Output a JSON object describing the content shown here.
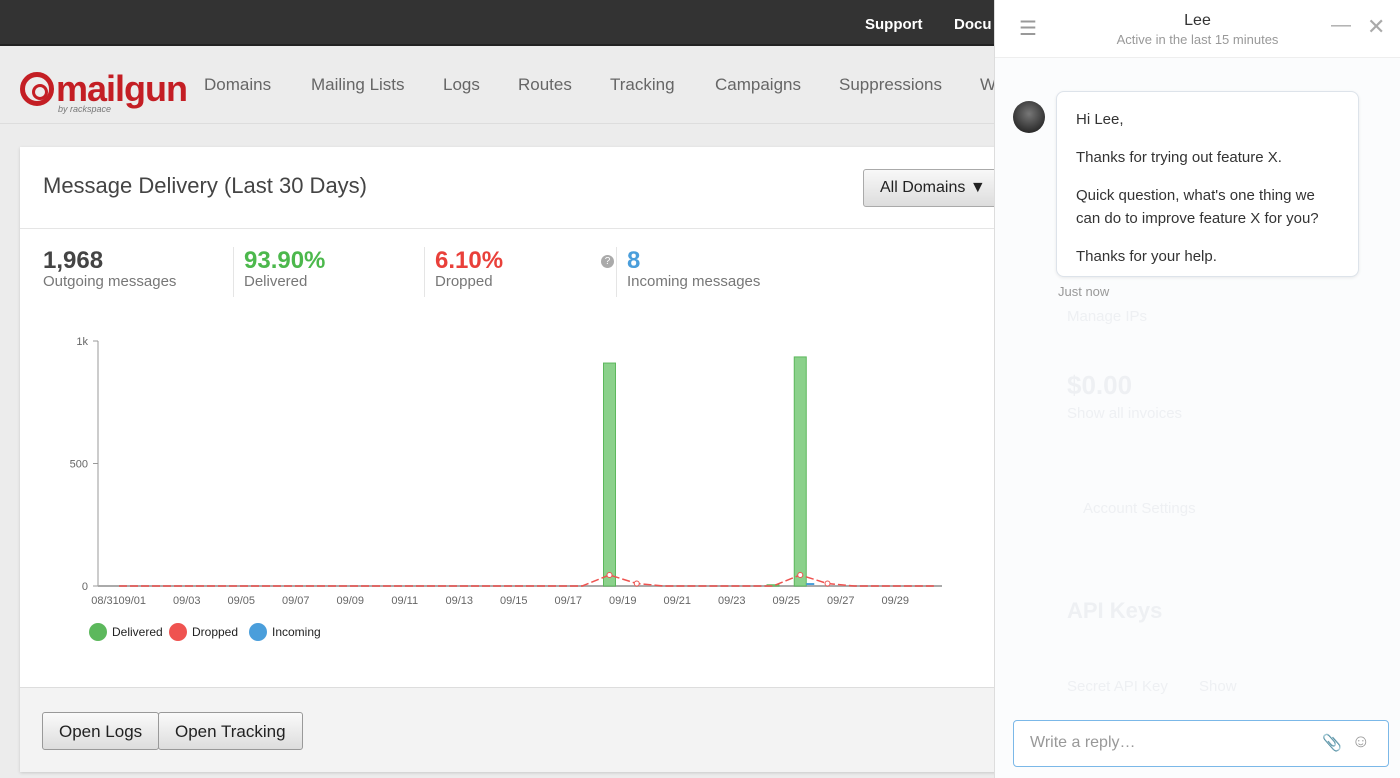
{
  "topbar": {
    "links": [
      "Support",
      "Docu"
    ]
  },
  "logo": {
    "text": "mailgun",
    "sub": "by rackspace"
  },
  "nav": {
    "items": [
      "Domains",
      "Mailing Lists",
      "Logs",
      "Routes",
      "Tracking",
      "Campaigns",
      "Suppressions",
      "W"
    ]
  },
  "card": {
    "title": "Message Delivery (Last 30 Days)",
    "domain_select": "All Domains",
    "stats": [
      {
        "value": "1,968",
        "label": "Outgoing messages",
        "color": "#444444"
      },
      {
        "value": "93.90%",
        "label": "Delivered",
        "color": "#4cb84c"
      },
      {
        "value": "6.10%",
        "label": "Dropped",
        "color": "#e9403a"
      },
      {
        "value": "8",
        "label": "Incoming messages",
        "color": "#4a9edb"
      }
    ],
    "buttons": {
      "open_logs": "Open Logs",
      "open_tracking": "Open Tracking"
    }
  },
  "chart_data": {
    "type": "bar",
    "ylim": [
      0,
      1000
    ],
    "yticks": [
      "0",
      "500",
      "1k"
    ],
    "xticks": [
      "08/31",
      "09/01",
      "09/03",
      "09/05",
      "09/07",
      "09/09",
      "09/11",
      "09/13",
      "09/15",
      "09/17",
      "09/19",
      "09/21",
      "09/23",
      "09/25",
      "09/27",
      "09/29"
    ],
    "x": [
      "08/31",
      "09/01",
      "09/02",
      "09/03",
      "09/04",
      "09/05",
      "09/06",
      "09/07",
      "09/08",
      "09/09",
      "09/10",
      "09/11",
      "09/12",
      "09/13",
      "09/14",
      "09/15",
      "09/16",
      "09/17",
      "09/18",
      "09/19",
      "09/20",
      "09/21",
      "09/22",
      "09/23",
      "09/24",
      "09/25",
      "09/26",
      "09/27",
      "09/28",
      "09/29",
      "09/30"
    ],
    "series": [
      {
        "name": "Delivered",
        "color": "#5cb85c",
        "type": "bar",
        "values": [
          0,
          0,
          0,
          0,
          0,
          0,
          0,
          0,
          0,
          0,
          0,
          0,
          0,
          0,
          0,
          0,
          0,
          0,
          910,
          0,
          0,
          0,
          0,
          0,
          5,
          935,
          0,
          0,
          0,
          0,
          0
        ]
      },
      {
        "name": "Dropped",
        "color": "#ef5350",
        "type": "line",
        "values": [
          0,
          0,
          0,
          0,
          0,
          0,
          0,
          0,
          0,
          0,
          0,
          0,
          0,
          0,
          0,
          0,
          0,
          0,
          45,
          10,
          0,
          0,
          0,
          0,
          0,
          45,
          10,
          0,
          0,
          0,
          0
        ]
      },
      {
        "name": "Incoming",
        "color": "#4a9edb",
        "type": "bar",
        "values": [
          0,
          0,
          0,
          0,
          0,
          0,
          0,
          0,
          0,
          0,
          0,
          0,
          0,
          0,
          0,
          0,
          0,
          0,
          0,
          0,
          0,
          0,
          0,
          0,
          0,
          8,
          0,
          0,
          0,
          0,
          0
        ]
      }
    ],
    "legend": "bottom-left"
  },
  "chat": {
    "name": "Lee",
    "status": "Active in the last 15 minutes",
    "messages": [
      "Hi Lee,",
      "Thanks for trying out feature X.",
      "Quick question, what's one thing we can do to improve feature X for you?",
      "Thanks for your help."
    ],
    "timestamp": "Just now",
    "reply_placeholder": "Write a reply…",
    "background": [
      "Manage IPs",
      "$0.00",
      "Show all invoices",
      "Account Settings",
      "API Keys",
      "Secret API Key",
      "Show"
    ]
  }
}
